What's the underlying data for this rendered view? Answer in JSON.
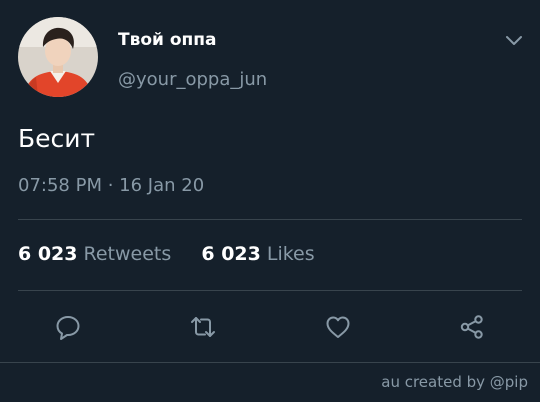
{
  "user": {
    "display_name": "Твой оппа",
    "handle": "@your_oppa_jun",
    "avatar_icon": "user-avatar"
  },
  "tweet": {
    "text": "Бесит",
    "timestamp": "07:58 PM · 16 Jan 20"
  },
  "stats": {
    "retweets_count": "6 023",
    "retweets_label": "Retweets",
    "likes_count": "6 023",
    "likes_label": "Likes"
  },
  "actions": {
    "reply_icon": "reply-icon",
    "retweet_icon": "retweet-icon",
    "like_icon": "heart-icon",
    "share_icon": "share-icon"
  },
  "footer": {
    "credit": "au created by @pip"
  },
  "colors": {
    "background": "#15202b",
    "text_primary": "#ffffff",
    "text_secondary": "#8899a6",
    "divider": "#38444d",
    "avatar_shirt": "#e2452a"
  }
}
